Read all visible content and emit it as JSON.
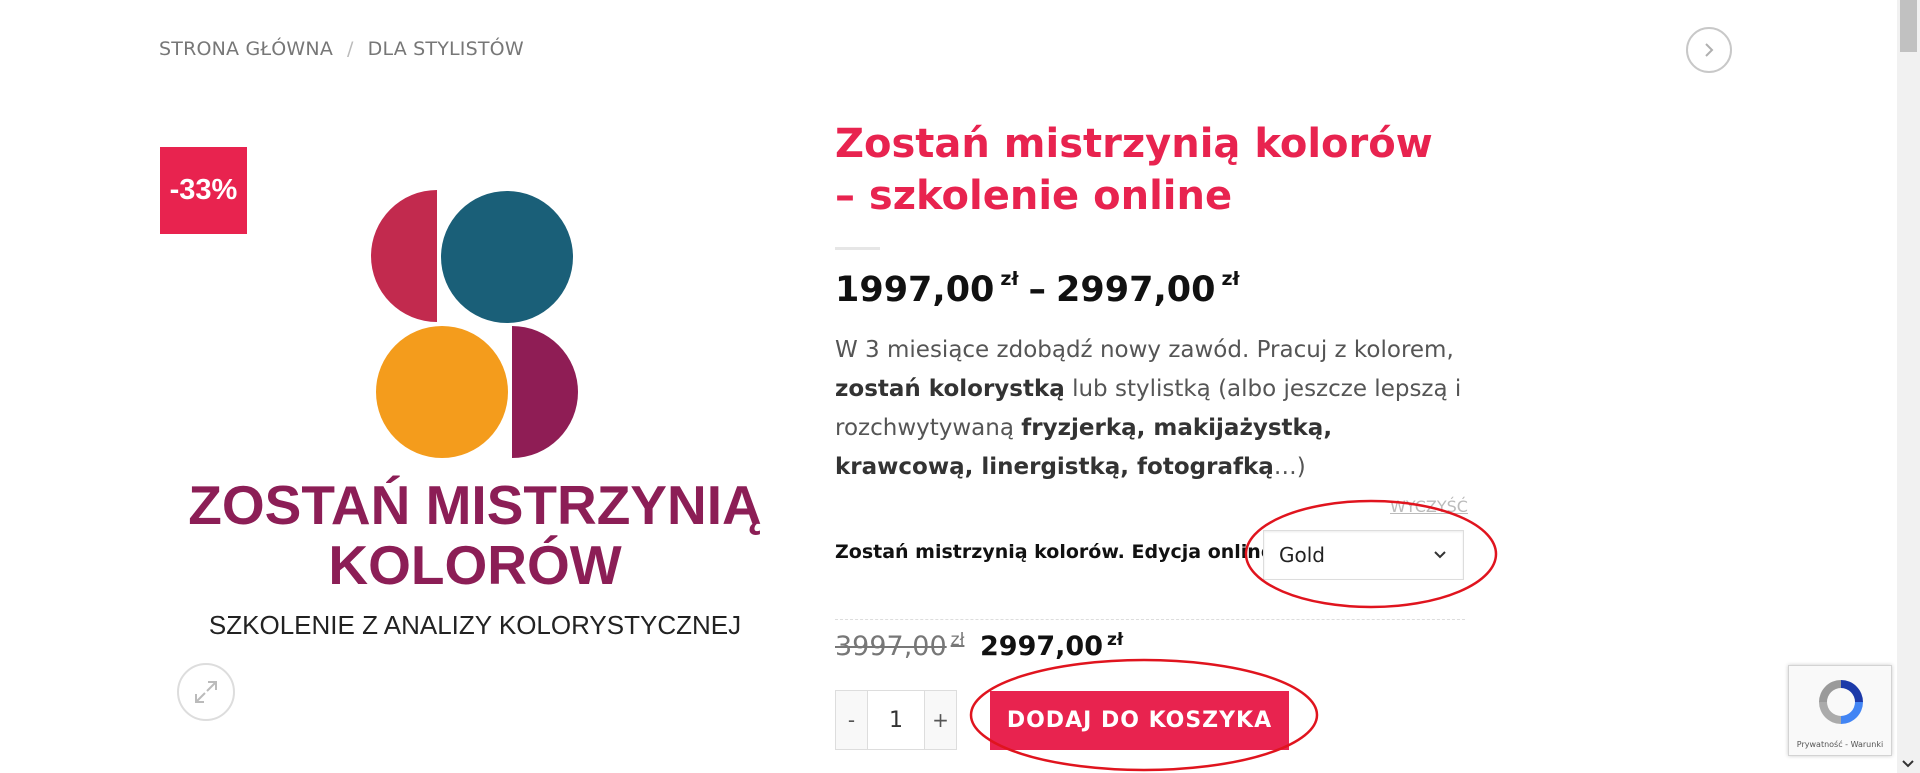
{
  "breadcrumb": {
    "home": "STRONA GŁÓWNA",
    "separator": "/",
    "category": "DLA STYLISTÓW"
  },
  "badge": {
    "discount": "-33%"
  },
  "product_image": {
    "title_line1": "ZOSTAŃ MISTRZYNIĄ",
    "title_line2": "KOLORÓW",
    "subtitle": "SZKOLENIE Z ANALIZY KOLORYSTYCZNEJ",
    "colors": {
      "red": "#c22a4e",
      "teal": "#1a5f78",
      "orange": "#f49c1c",
      "plum": "#8f1d55"
    }
  },
  "product": {
    "title": "Zostań mistrzynią kolorów – szkolenie online",
    "price_min": "1997,00",
    "price_max": "2997,00",
    "currency": "zł",
    "price_dash": "–",
    "desc_1": "W 3 miesiące zdobądź nowy zawód. Pracuj z kolorem, ",
    "desc_b1": "zostań kolorystką",
    "desc_2": " lub stylistką (albo jeszcze lepszą i rozchwytywaną ",
    "desc_b2": "fryzjerką, makijażystką, krawcową, linergistką, fotografką",
    "desc_3": "…)"
  },
  "variation": {
    "clear_label": "WYCZYŚĆ",
    "label": "Zostań mistrzynią kolorów. Edycja online",
    "selected": "Gold"
  },
  "selected_price": {
    "old": "3997,00",
    "new": "2997,00",
    "currency": "zł"
  },
  "cart": {
    "minus": "-",
    "quantity": "1",
    "plus": "+",
    "add_label": "DODAJ DO KOSZYKA"
  },
  "recaptcha": {
    "links": "Prywatność - Warunki"
  },
  "theme": {
    "accent": "#e8234f",
    "annotation": "#e0141e"
  }
}
